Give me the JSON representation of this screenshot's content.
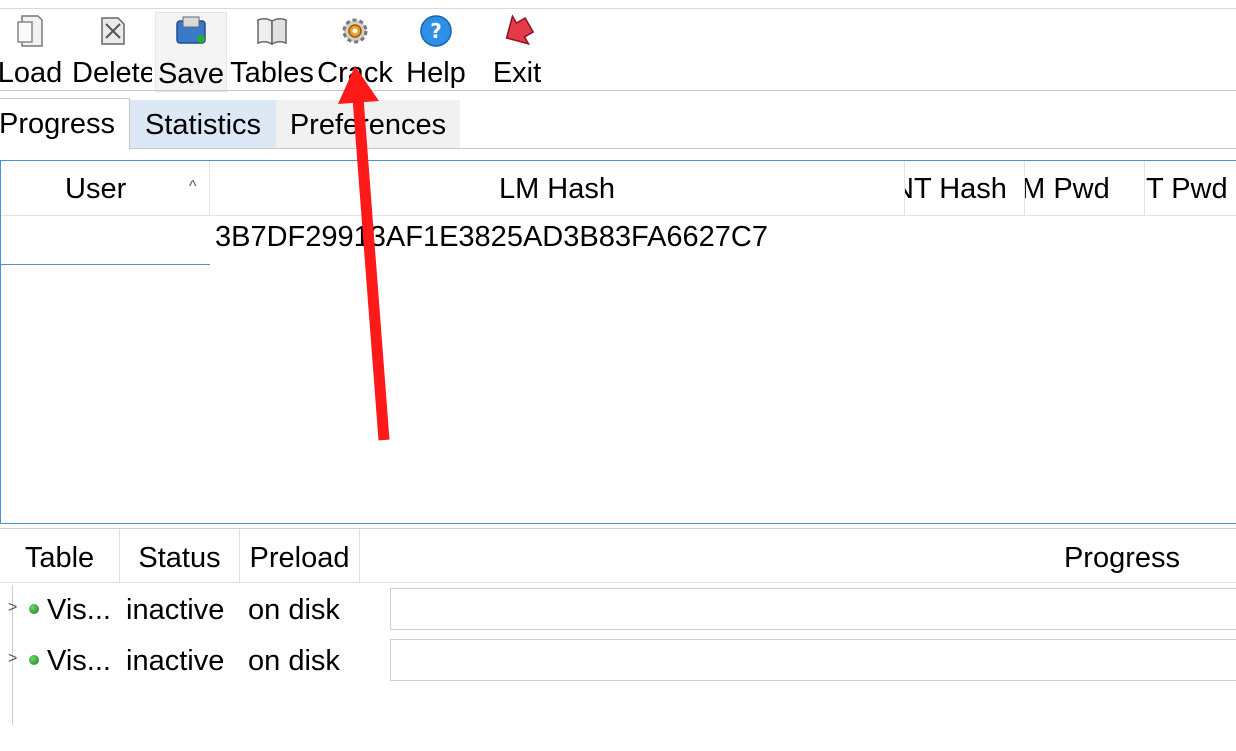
{
  "toolbar": {
    "load": "Load",
    "delete": "Delete",
    "save": "Save",
    "tables": "Tables",
    "crack": "Crack",
    "help": "Help",
    "exit": "Exit"
  },
  "tabs": {
    "progress": "Progress",
    "statistics": "Statistics",
    "preferences": "Preferences"
  },
  "hash_table": {
    "columns": [
      "User",
      "LM Hash",
      "NT Hash",
      "LM Pwd",
      "NT Pwd"
    ],
    "rows": [
      {
        "user": "",
        "lm_hash": "3B7DF29913AF1E3825AD3B83FA6627C7"
      }
    ]
  },
  "rainbow_tables": {
    "columns": [
      "Table",
      "Status",
      "Preload",
      "Progress"
    ],
    "rows": [
      {
        "table": "Vis...",
        "status": "inactive",
        "preload": "on disk"
      },
      {
        "table": "Vis...",
        "status": "inactive",
        "preload": "on disk"
      }
    ]
  },
  "annotation": {
    "color": "#ff1a1a"
  }
}
